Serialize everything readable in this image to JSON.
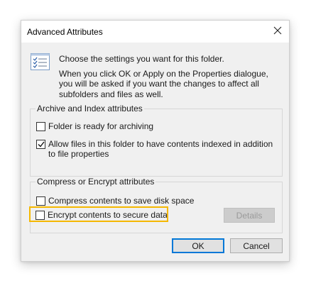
{
  "dialog": {
    "title": "Advanced Attributes",
    "close_label": "X"
  },
  "intro": {
    "icon": "attributes-list-icon",
    "line1": "Choose the settings you want for this folder.",
    "line2": "When you click OK or Apply on the Properties dialogue, you will be asked if you want the changes to affect all subfolders and files as well."
  },
  "archive_group": {
    "title": "Archive and Index attributes",
    "folder_ready": {
      "label": "Folder is ready for archiving",
      "checked": false
    },
    "allow_index": {
      "label": "Allow files in this folder to have contents indexed in addition to file properties",
      "checked": true
    }
  },
  "compress_group": {
    "title": "Compress or Encrypt attributes",
    "compress": {
      "label": "Compress contents to save disk space",
      "checked": false
    },
    "encrypt": {
      "label": "Encrypt contents to secure data",
      "checked": false
    },
    "details_label": "Details"
  },
  "buttons": {
    "ok_label": "OK",
    "cancel_label": "Cancel"
  },
  "colors": {
    "highlight": "#f5b800",
    "accent": "#0078d7"
  }
}
